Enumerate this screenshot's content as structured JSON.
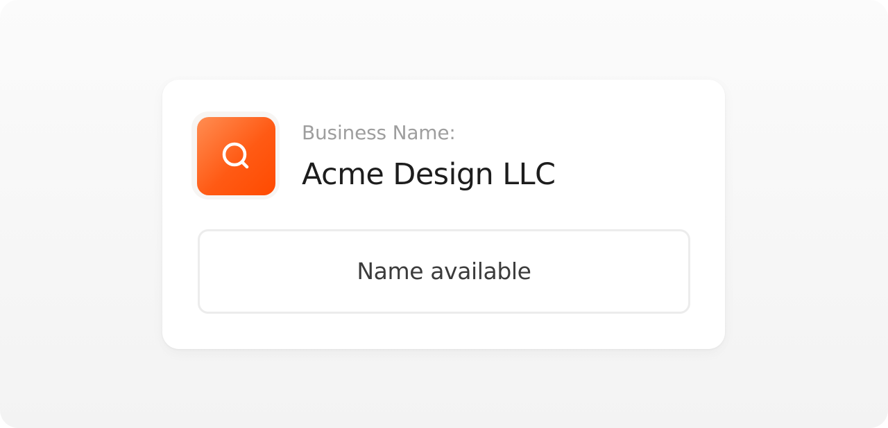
{
  "card": {
    "icon": "search-icon",
    "accent_color": "#ff5a14",
    "label": "Business Name:",
    "business_name": "Acme Design LLC",
    "status": "Name available"
  }
}
